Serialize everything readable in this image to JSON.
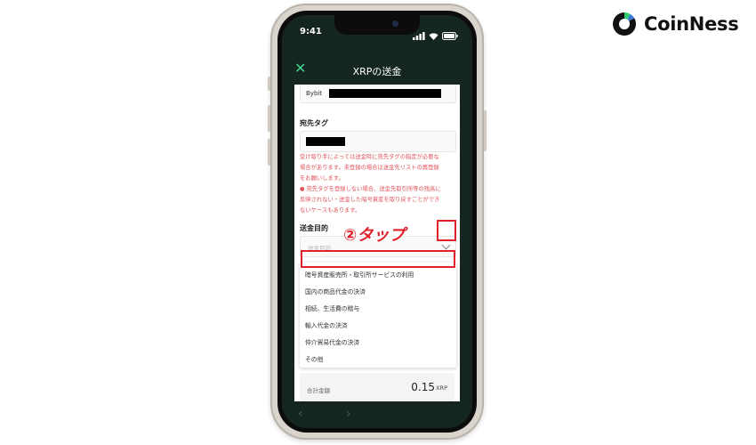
{
  "brand": {
    "name": "CoinNess"
  },
  "status": {
    "time": "9:41"
  },
  "header": {
    "title": "XRPの送金"
  },
  "address": {
    "label": "Bybit"
  },
  "dest_tag": {
    "label": "宛先タグ"
  },
  "warning": {
    "line1": "受け取り手によっては送金時に宛先タグの指定が必要な",
    "line2": "場合があります。未登録の場合は送金先リストの再登録",
    "line3": "をお願いします。",
    "line4": "● 宛先タグを登録しない場合、送金先取引所等の残高に",
    "line5": "反映されない・送金した暗号資産を取り戻すことができ",
    "line6": "ないケースもあります。"
  },
  "purpose": {
    "label": "送金目的",
    "placeholder": "送金目的"
  },
  "annotation": {
    "tap_label": "②タップ",
    "accent_color": "#e0202a"
  },
  "options": [
    "暗号資産販売所・取引所サービスの利用",
    "国内の商品代金の決済",
    "相続、生活費の贈与",
    "輸入代金の決済",
    "仲介貿易代金の決済",
    "その他"
  ],
  "total": {
    "label": "合計金額",
    "value": "0.15",
    "unit": "XRP"
  }
}
